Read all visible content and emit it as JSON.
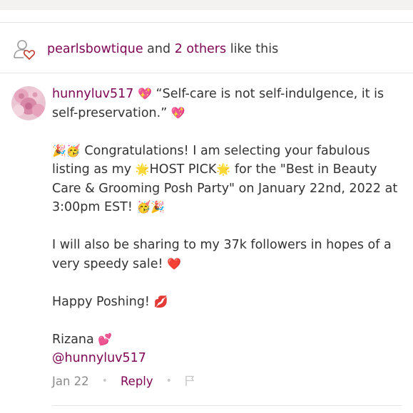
{
  "likes": {
    "user": "pearlsbowtique",
    "connector": "and",
    "others": "2 others",
    "suffix": "like this"
  },
  "comment": {
    "username": "hunnyluv517",
    "quote": "“Self-care is not self-indulgence, it is self-preservation.”",
    "paragraph_1": "Congratulations! I am selecting your fabulous listing as my",
    "host_pick": "HOST PICK",
    "paragraph_1_end": "for the \"Best in Beauty Care & Grooming Posh Party\" on January 22nd, 2022 at 3:00pm EST!",
    "paragraph_2": "I will also be sharing to my 37k followers in hopes of a very speedy sale!",
    "paragraph_3": "Happy Poshing!",
    "signature_name": "Rizana",
    "signature_handle": "@hunnyluv517",
    "date": "Jan 22",
    "reply_label": "Reply"
  },
  "icons": {
    "likes": "user-heart-icon",
    "sparkle_heart": "sparkling-heart-emoji",
    "party": "party-popper-emoji",
    "partying_face": "partying-face-emoji",
    "star": "glowing-star-emoji",
    "red_heart": "red-heart-emoji",
    "lips": "kiss-mark-emoji",
    "two_hearts": "two-hearts-emoji",
    "flag": "flag-icon"
  },
  "colors": {
    "accent": "#7f0353",
    "text": "#333333",
    "muted": "#8a8a8a"
  }
}
